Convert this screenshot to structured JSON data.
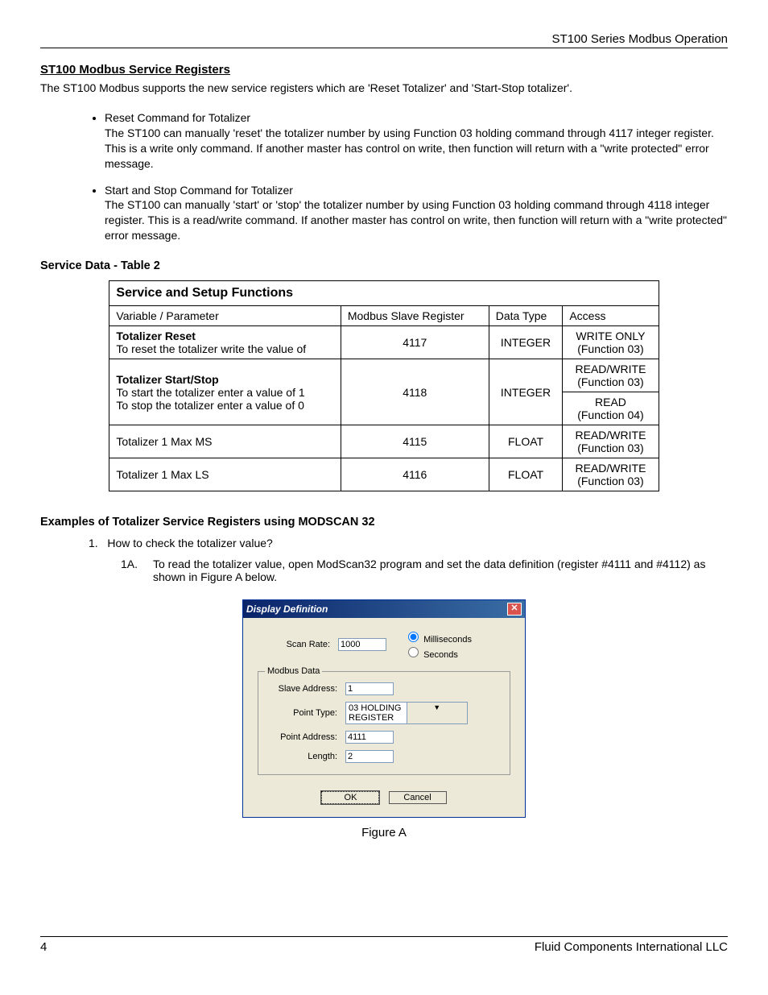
{
  "header": {
    "doc_title": "ST100 Series Modbus Operation"
  },
  "section": {
    "title": "ST100 Modbus Service Registers",
    "intro": "The ST100 Modbus supports the new service registers which are 'Reset Totalizer' and 'Start-Stop totalizer'.",
    "bullets": [
      {
        "title": "Reset Command for Totalizer",
        "body": "The ST100 can manually 'reset' the totalizer number by using Function 03 holding command through 4117 integer register. This is a write only command. If another master has control on write, then function will return with a \"write protected\" error message."
      },
      {
        "title": "Start and Stop Command for Totalizer",
        "body": "The ST100 can manually 'start' or 'stop' the totalizer number by using Function 03 holding command through 4118 integer register. This is a read/write command. If another master has control on write, then function will return with a \"write protected\" error message."
      }
    ]
  },
  "table2": {
    "heading": "Service Data - Table 2",
    "title": "Service and Setup Functions",
    "cols": [
      "Variable / Parameter",
      "Modbus Slave Register",
      "Data Type",
      "Access"
    ],
    "rows": [
      {
        "param_bold": "Totalizer Reset",
        "param_rest": "To reset the totalizer write the value of",
        "reg": "4117",
        "type": "INTEGER",
        "access": "WRITE ONLY (Function 03)"
      },
      {
        "param_bold": "Totalizer Start/Stop",
        "param_rest": "To start the totalizer enter a value of 1\nTo stop the totalizer enter a value of 0",
        "reg": "4118",
        "type": "INTEGER",
        "access": "READ/WRITE (Function 03)\nREAD (Function 04)"
      },
      {
        "param_bold": "",
        "param_rest": "Totalizer 1 Max MS",
        "reg": "4115",
        "type": "FLOAT",
        "access": "READ/WRITE (Function 03)"
      },
      {
        "param_bold": "",
        "param_rest": "Totalizer 1 Max LS",
        "reg": "4116",
        "type": "FLOAT",
        "access": "READ/WRITE (Function 03)"
      }
    ]
  },
  "examples": {
    "heading": "Examples of Totalizer Service Registers  using MODSCAN 32",
    "item1": "How to check the totalizer value?",
    "item1a_num": "1A.",
    "item1a_body": "To read the totalizer value, open ModScan32 program and set the data definition (register #4111 and #4112) as shown in Figure A below."
  },
  "dialog": {
    "title": "Display Definition",
    "scan_rate_label": "Scan Rate:",
    "scan_rate_value": "1000",
    "unit_ms": "Milliseconds",
    "unit_s": "Seconds",
    "group_label": "Modbus Data",
    "slave_addr_label": "Slave Address:",
    "slave_addr_value": "1",
    "point_type_label": "Point Type:",
    "point_type_value": "03 HOLDING REGISTER",
    "point_addr_label": "Point Address:",
    "point_addr_value": "4111",
    "length_label": "Length:",
    "length_value": "2",
    "ok": "OK",
    "cancel": "Cancel"
  },
  "figure_caption": "Figure A",
  "footer": {
    "page": "4",
    "company": "Fluid Components International LLC"
  }
}
